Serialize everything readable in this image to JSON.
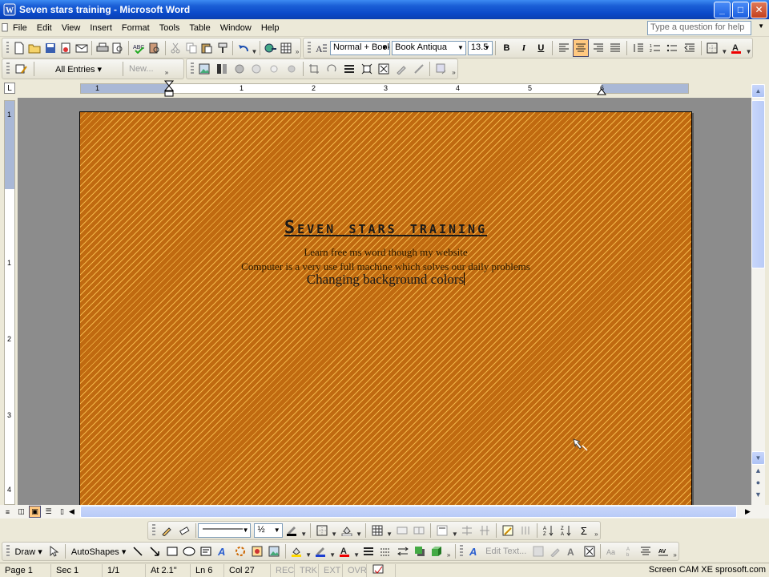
{
  "window": {
    "title": "Seven stars training - Microsoft Word",
    "controls": {
      "minimize": "_",
      "maximize": "□",
      "close": "✕"
    }
  },
  "menu": {
    "items": [
      "File",
      "Edit",
      "View",
      "Insert",
      "Format",
      "Tools",
      "Table",
      "Window",
      "Help"
    ],
    "help_placeholder": "Type a question for help"
  },
  "formatting": {
    "style": "Normal + Book",
    "font": "Book Antiqua",
    "size": "13.5"
  },
  "reviewing": {
    "entries": "All Entries",
    "new_label": "New..."
  },
  "ruler": {
    "numbers": [
      "1",
      "1",
      "2",
      "3",
      "4",
      "5",
      "6"
    ]
  },
  "vruler": {
    "numbers": [
      "1",
      "1",
      "2",
      "3",
      "4"
    ]
  },
  "document": {
    "title": "Seven stars training",
    "line1": "Learn free ms word though my website",
    "line2": "Computer is a very use full machine which solves our daily problems",
    "heading": "Changing background colors"
  },
  "drawing": {
    "draw_label": "Draw",
    "autoshapes_label": "AutoShapes",
    "edit_text_label": "Edit Text...",
    "line_weight": "½"
  },
  "status": {
    "page": "Page 1",
    "sec": "Sec 1",
    "pages": "1/1",
    "at": "At 2.1\"",
    "ln": "Ln 6",
    "col": "Col 27",
    "rec": "REC",
    "trk": "TRK",
    "ext": "EXT",
    "ovr": "OVR",
    "watermark": "Screen CAM XE sprosoft.com"
  },
  "colors": {
    "titlebar": "#0a49c9",
    "page_base": "#c06a10",
    "page_stripe": "#f2b64a"
  }
}
